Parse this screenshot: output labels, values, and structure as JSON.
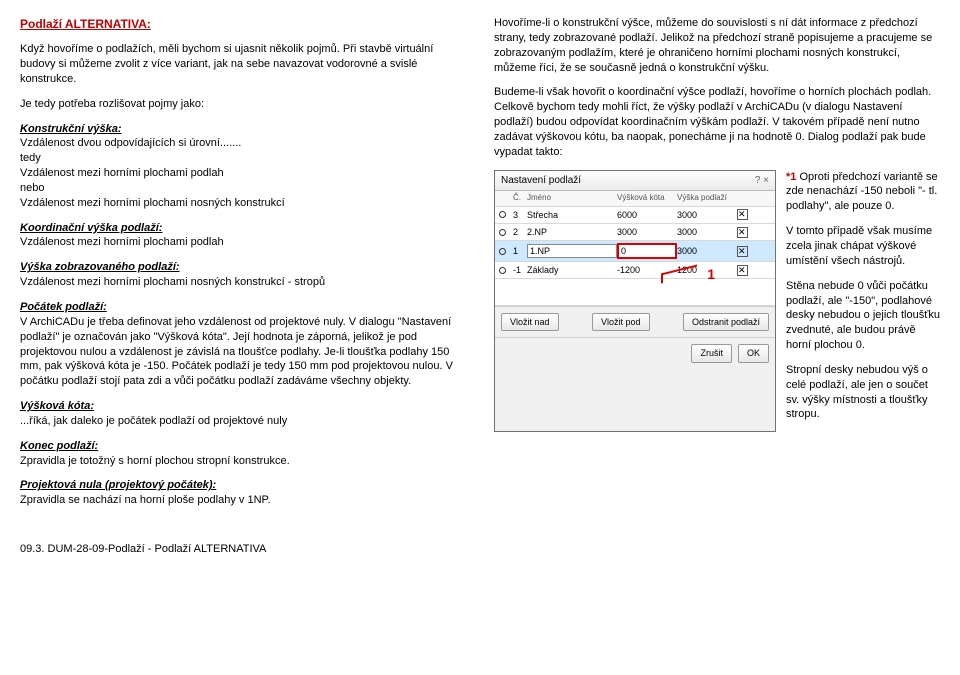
{
  "title": "Podlaží ALTERNATIVA:",
  "left": {
    "p1": "Když hovoříme o podlažích, měli bychom si ujasnit několik pojmů. Při stavbě virtuální budovy si můžeme zvolit z více variant, jak na sebe navazovat vodorovné a svislé konstrukce.",
    "p2": "Je tedy potřeba rozlišovat pojmy jako:",
    "h1": "Konstrukční výška:",
    "p3": "Vzdálenost dvou odpovídajících si úrovní.......",
    "p3b": "tedy",
    "p3c": "Vzdálenost mezi horními plochami podlah",
    "p3d": "nebo",
    "p3e": "Vzdálenost mezi horními plochami nosných konstrukcí",
    "h2": "Koordinační výška podlaží:",
    "p4": "Vzdálenost mezi horními plochami podlah",
    "h3": "Výška zobrazovaného podlaží:",
    "p5": "Vzdálenost mezi horními plochami nosných konstrukcí - stropů",
    "h4": "Počátek podlaží:",
    "p6": "V ArchiCADu je třeba definovat jeho vzdálenost od projektové nuly. V dialogu \"Nastavení podlaží\" je označován jako \"Výšková kóta\". Její hodnota je záporná, jelikož je pod projektovou nulou a vzdálenost je závislá na tloušťce podlahy. Je-li tloušťka podlahy 150 mm, pak výšková kóta je -150. Počátek podlaží je tedy 150 mm pod projektovou nulou. V počátku podlaží stojí pata zdi a vůči počátku podlaží zadáváme všechny objekty.",
    "h5": "Výšková kóta:",
    "p7": "...říká, jak daleko je počátek podlaží od projektové nuly",
    "h6": "Konec podlaží:",
    "p8": "Zpravidla je totožný s horní plochou stropní konstrukce.",
    "h7": "Projektová nula (projektový počátek):",
    "p9": "Zpravidla se nachází na horní ploše podlahy v 1NP."
  },
  "right": {
    "p1": "Hovoříme-li o konstrukční výšce, můžeme do souvislosti s ní dát informace z předchozí strany, tedy zobrazované podlaží. Jelikož na předchozí straně popisujeme a pracujeme se zobrazovaným podlažím, které je ohraničeno horními plochami nosných konstrukcí, můžeme říci, že se současně jedná o konstrukční výšku.",
    "p2": "Budeme-li však hovořit o koordinační výšce podlaží, hovoříme o horních plochách podlah. Celkově bychom tedy mohli říct, že výšky podlaží v ArchiCADu (v dialogu Nastavení podlaží) budou odpovídat koordinačním výškám podlaží. V takovém případě není nutno zadávat výškovou kótu, ba naopak, ponecháme ji na hodnotě 0. Dialog podlaží pak bude vypadat takto:",
    "side1a": " Oproti předchozí variantě se zde nenachází -150 neboli \"- tl. podlahy\", ale pouze 0.",
    "side2": "V tomto případě však musíme zcela jinak chápat výškové umístění všech nástrojů.",
    "side3": "Stěna nebude 0 vůči počátku podlaží, ale \"-150\", podlahové desky nebudou o jejich tloušťku zvednuté, ale budou právě horní plochou 0.",
    "side4": "Stropní desky nebudou výš o celé podlaží, ale jen o součet sv. výšky místnosti a tloušťky stropu.",
    "annot1": "1",
    "star": "*1"
  },
  "dlg": {
    "title": "Nastavení podlaží",
    "qmark": "?",
    "close": "×",
    "head": {
      "c": "Č.",
      "n": "Jméno",
      "k": "Výšková kóta",
      "v": "Výška podlaží",
      "r": ""
    },
    "rows": [
      {
        "n": "3",
        "name": "Střecha",
        "kota": "6000",
        "vys": "3000"
      },
      {
        "n": "2",
        "name": "2.NP",
        "kota": "3000",
        "vys": "3000"
      },
      {
        "n": "1",
        "name": "1.NP",
        "kota": "0",
        "vys": "3000",
        "sel": true,
        "hl": true
      },
      {
        "n": "-1",
        "name": "Základy",
        "kota": "-1200",
        "vys": "1200"
      }
    ],
    "b1": "Vložit nad",
    "b2": "Vložit pod",
    "b3": "Odstranit podlaží",
    "b4": "Zrušit",
    "b5": "OK"
  },
  "footer": "09.3. DUM-28-09-Podlaží - Podlaží ALTERNATIVA"
}
